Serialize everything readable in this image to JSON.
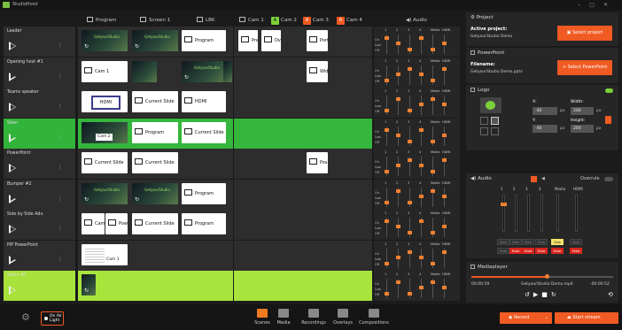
{
  "app": {
    "title": "StudioHoist"
  },
  "outputs": [
    {
      "label": "Program",
      "icon": "program-icon"
    },
    {
      "label": "Screen 1",
      "icon": "monitor-icon"
    },
    {
      "label": "LBK",
      "icon": "monitor-icon"
    },
    {
      "label": "Cam 1",
      "icon": "layout-icon"
    },
    {
      "label": "Cam 2",
      "badge": "A",
      "color": "#7bd23a"
    },
    {
      "label": "Cam 3",
      "badge": "A",
      "color": "#f05a23"
    },
    {
      "label": "Cam 4",
      "badge": "A",
      "color": "#f05a23"
    },
    {
      "label": "Audio",
      "icon": "speaker-icon"
    }
  ],
  "rows": [
    {
      "name": "Leader",
      "tiles": [
        "",
        "",
        "Program",
        "Preset 1",
        "Overview",
        "Portrait Host"
      ]
    },
    {
      "name": "Opening host #1",
      "tiles": [
        "Cam 1",
        "",
        "",
        "S",
        "Wide-Shot"
      ]
    },
    {
      "name": "Teams speaker",
      "tiles": [
        "HDMI",
        "Current Slide",
        "HDMI"
      ]
    },
    {
      "name": "Weer",
      "tiles": [
        "Cam 2",
        "Program",
        "Current Slide"
      ]
    },
    {
      "name": "PowerPoint",
      "tiles": [
        "Current Slide",
        "Current Slide",
        "Pos. 2"
      ]
    },
    {
      "name": "Bumper #2",
      "tiles": [
        "",
        "",
        "Program"
      ]
    },
    {
      "name": "Side by Side Adv.",
      "tiles": [
        "Cam 1",
        "PowerPo",
        "Current Slide",
        "Program"
      ]
    },
    {
      "name": "PiP PowerPoint",
      "tiles": [
        "Cam 1"
      ]
    },
    {
      "name": "Video #1",
      "tiles": []
    }
  ],
  "brand_text": "GetyourStudio",
  "mixer": {
    "levels": [
      "On",
      "Low",
      "Off"
    ],
    "channels": [
      "1",
      "2",
      "3",
      "4",
      "Media",
      "HDMI"
    ]
  },
  "project": {
    "title": "Project",
    "active_label": "Active project:",
    "active_value": "GetyourStudio Demo",
    "select_button": "Select project"
  },
  "powerpoint": {
    "title": "PowerPoint",
    "filename_label": "Filename:",
    "filename_value": "GetyourStudio Demo.pptx",
    "select_button": "+ Select PowerPoint"
  },
  "logo": {
    "title": "Logo",
    "x_label": "X:",
    "x_value": "-40",
    "y_label": "Y:",
    "y_value": "-40",
    "width_label": "Width:",
    "width_value": "200",
    "height_label": "Height:",
    "height_value": "200",
    "unit": "px"
  },
  "audio": {
    "title": "Audio",
    "overrule_label": "Overrule",
    "channels": [
      "1",
      "2",
      "3",
      "4",
      "Media",
      "HDMI"
    ],
    "solo_label": "Solo",
    "mute_label": "Mute"
  },
  "mediaplayer": {
    "title": "Mediaplayer",
    "elapsed": "00:00:59",
    "file": "GetyourStudio Demo.mp4",
    "remaining": "-00:00:52",
    "progress": 0.53
  },
  "bottom": {
    "onair_label": "On Air Light",
    "nav": [
      "Scenes",
      "Media",
      "Recordings",
      "Overlays",
      "Compositions"
    ],
    "record_button": "Record",
    "stream_button": "Start stream"
  }
}
